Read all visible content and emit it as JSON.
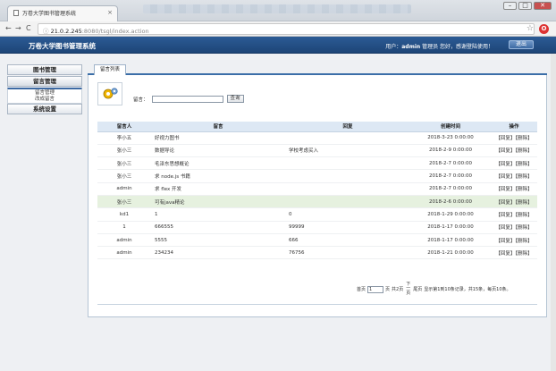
{
  "browser": {
    "tab_title": "万卷大学图书管理系统",
    "tab_close": "×",
    "url_host": "21.0.2.245",
    "url_rest": ":8080/tsgl/index.action",
    "url_info": "ⓘ",
    "back_icon": "←",
    "forward_icon": "→",
    "reload_icon": "C",
    "star_icon": "☆",
    "opera_icon": "O",
    "win_min": "–",
    "win_max": "□",
    "win_close": "✕"
  },
  "header": {
    "title": "万卷大学图书管理系统",
    "user_prefix": "用户：",
    "user_name": "admin",
    "user_suffix": " 管理员 您好，感谢登陆使用！",
    "logout_label": "退出"
  },
  "sidebar": {
    "sections": [
      {
        "label": "图书管理"
      },
      {
        "label": "留言管理"
      },
      {
        "label": "系统设置"
      }
    ],
    "items": [
      {
        "label": "留言管理"
      },
      {
        "label": "改成留言"
      }
    ]
  },
  "panel": {
    "tab_label": "留言列表",
    "search_label": "留言：",
    "search_value": "",
    "search_button": "查询"
  },
  "table": {
    "headers": [
      "留言人",
      "留言",
      "回复",
      "创建时间",
      "操作"
    ],
    "rows": [
      {
        "author": "李小五",
        "message": "好视力图书",
        "reply": "",
        "created": "2018-3-23 0:00:00"
      },
      {
        "author": "张小三",
        "message": "数据导论",
        "reply": "学校考虑买入",
        "created": "2018-2-9 0:00:00"
      },
      {
        "author": "张小三",
        "message": "毛泽东思想概论",
        "reply": "",
        "created": "2018-2-7 0:00:00"
      },
      {
        "author": "张小三",
        "message": "求 node.js 书籍",
        "reply": "",
        "created": "2018-2-7 0:00:00"
      },
      {
        "author": "admin",
        "message": "求 flex 开发",
        "reply": "",
        "created": "2018-2-7 0:00:00"
      },
      {
        "author": "张小三",
        "message": "可有java精论",
        "reply": "",
        "created": "2018-2-6 0:00:00"
      },
      {
        "author": "kd1",
        "message": "1",
        "reply": "0",
        "created": "2018-1-29 0:00:00"
      },
      {
        "author": "1",
        "message": "666555",
        "reply": "99999",
        "created": "2018-1-17 0:00:00"
      },
      {
        "author": "admin",
        "message": "5555",
        "reply": "666",
        "created": "2018-1-17 0:00:00"
      },
      {
        "author": "admin",
        "message": "234234",
        "reply": "76756",
        "created": "2018-1-21 0:00:00"
      }
    ],
    "reply_action": "【回复】",
    "delete_action": "【删除】",
    "highlight_row_index": 5,
    "highlight_color": "#e6f1df"
  },
  "pager": {
    "first_label": "首页",
    "page_value": "1",
    "page_suffix": "页",
    "total_label": "共2页",
    "next_label": "下一页",
    "last_label": "尾页",
    "summary": "显示第1到10条记录，共15条，每页10条。"
  },
  "colors": {
    "header_blue": "#1d4577",
    "table_header_bg": "#dde8f4"
  }
}
